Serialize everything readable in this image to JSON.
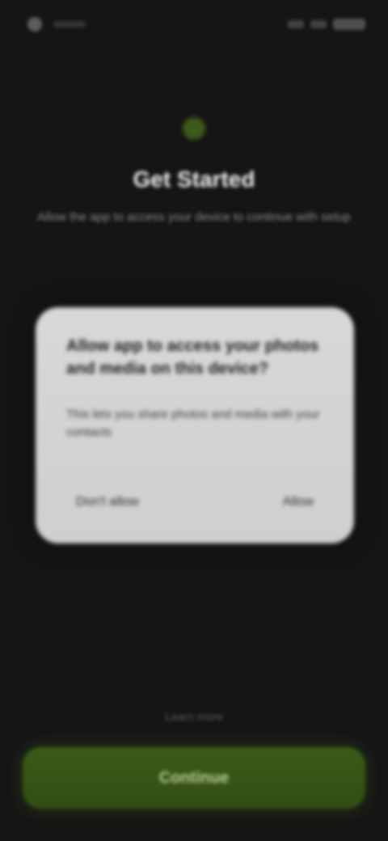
{
  "status_bar": {
    "time": "",
    "battery": ""
  },
  "header": {
    "title": "Get Started",
    "subtitle": "Allow the app to access your device to continue with setup"
  },
  "dialog": {
    "title": "Allow app to access your photos and media on this device?",
    "body": "This lets you share photos and media with your contacts",
    "deny_label": "Don't allow",
    "allow_label": "Allow"
  },
  "footer": {
    "hint": "Learn more",
    "primary_button_label": "Continue"
  },
  "colors": {
    "background": "#151515",
    "dialog": "#d4d4d4",
    "primary": "#3a5518",
    "primary_text": "#b8cf96"
  },
  "icons": {
    "brand": "leaf-icon"
  }
}
